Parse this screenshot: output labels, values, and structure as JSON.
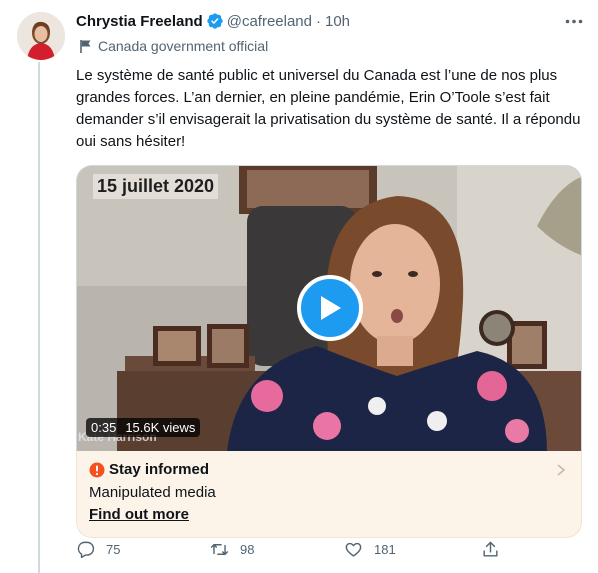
{
  "tweet": {
    "author_name": "Chrystia Freeland",
    "handle": "@cafreeland",
    "separator": "·",
    "time": "10h",
    "account_label": "Canada government official",
    "text": "Le système de santé public et universel du Canada est l’une de nos plus grandes forces. L’an dernier, en pleine pandémie, Erin O’Toole s’est fait demander s’il envisagerait la privatisation du système de santé. Il a répondu oui sans hésiter!"
  },
  "video": {
    "date_overlay": "15 juillet 2020",
    "duration": "0:35",
    "views": "15.6K views",
    "speaker_nameplate": "Kate Harrison"
  },
  "notice": {
    "title": "Stay informed",
    "subtitle": "Manipulated media",
    "link": "Find out more"
  },
  "actions": {
    "replies": "75",
    "retweets": "98",
    "likes": "181"
  },
  "colors": {
    "accent": "#1d9bf0",
    "notice_bg": "#fdf4e9",
    "alert": "#f4511e",
    "muted": "#536471"
  },
  "icons": [
    "verified-badge-icon",
    "more-icon",
    "flag-icon",
    "play-icon",
    "alert-icon",
    "chevron-right-icon",
    "reply-icon",
    "retweet-icon",
    "like-icon",
    "share-icon"
  ]
}
